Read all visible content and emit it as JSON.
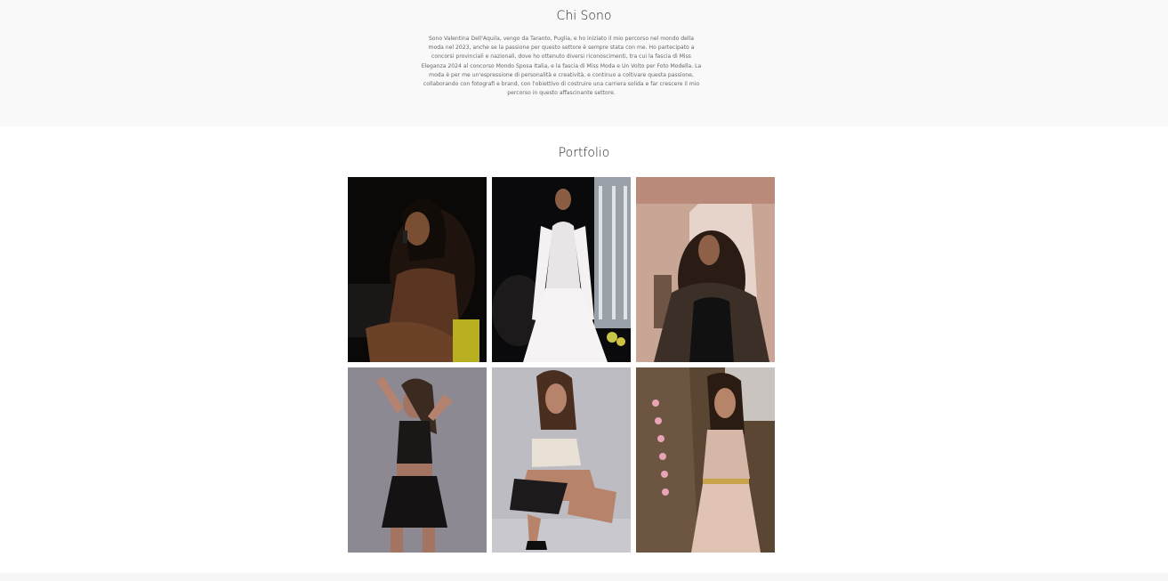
{
  "about": {
    "title": "Chi Sono",
    "text": "Sono Valentina Dell'Aquila, vengo da Taranto, Puglia, e ho iniziato il mio percorso nel mondo della moda nel 2023, anche se la passione per questo settore è sempre stata con me. Ho partecipato a concorsi provinciali e nazionali, dove ho ottenuto diversi riconoscimenti, tra cui la fascia di Miss Eleganza 2024 al concorso Mondo Sposa Italia, e la fascia di Miss Moda e Un Volto per Foto Modella. La moda è per me un'espressione di personalità e creatività, e continuo a coltivare questa passione, collaborando con fotografi e brand, con l'obiettivo di costruire una carriera solida e far crescere il mio percorso in questo affascinante settore."
  },
  "portfolio": {
    "title": "Portfolio",
    "photos": [
      {
        "subject": "woman-on-phone-night-photo"
      },
      {
        "subject": "white-bridal-gown-runway-photo"
      },
      {
        "subject": "woman-sequin-jacket-arch-photo"
      },
      {
        "subject": "black-top-skirt-studio-photo"
      },
      {
        "subject": "crouching-pose-studio-photo"
      },
      {
        "subject": "pink-sequin-dress-flowers-photo"
      }
    ]
  }
}
